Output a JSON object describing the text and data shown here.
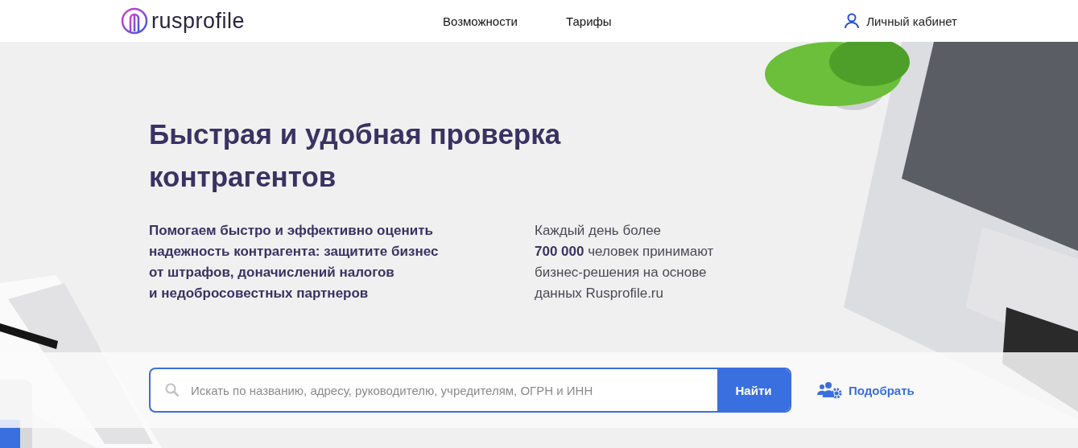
{
  "header": {
    "logo": "rusprofile",
    "nav": [
      "Возможности",
      "Тарифы"
    ],
    "account": "Личный кабинет"
  },
  "hero": {
    "title": [
      "Быстрая и удобная проверка",
      "контрагентов"
    ],
    "lead": [
      "Помогаем быстро и эффективно оценить",
      "надежность контрагента: защитите бизнес",
      "от штрафов, доначислений налогов",
      "и недобросовестных партнеров"
    ],
    "stats": [
      "Каждый день более",
      "**700 000** человек принимают",
      "бизнес-решения на основе",
      "данных Rusprofile.ru"
    ]
  },
  "search": {
    "placeholder": "Искать по названию, адресу, руководителю, учредителям, ОГРН и ИНН",
    "button": "Найти"
  },
  "pick": {
    "label": "Подобрать"
  }
}
